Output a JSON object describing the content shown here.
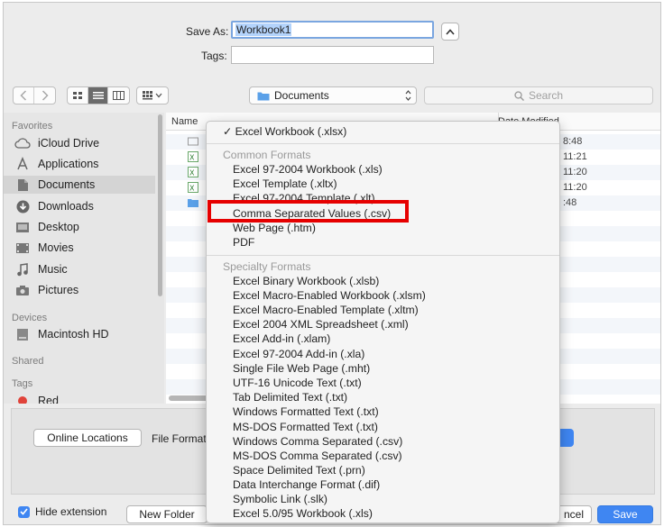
{
  "save_as": {
    "label": "Save As:",
    "value": "Workbook1"
  },
  "tags": {
    "label": "Tags:",
    "value": ""
  },
  "toolbar": {
    "location": "Documents",
    "search_placeholder": "Search"
  },
  "sidebar": {
    "favorites_heading": "Favorites",
    "favorites": [
      "iCloud Drive",
      "Applications",
      "Documents",
      "Downloads",
      "Desktop",
      "Movies",
      "Music",
      "Pictures"
    ],
    "devices_heading": "Devices",
    "devices": [
      "Macintosh HD"
    ],
    "shared_heading": "Shared",
    "tags_heading": "Tags",
    "tags": [
      "Red"
    ]
  },
  "file_list": {
    "name_header": "Name",
    "date_header": "Date Modified",
    "times": [
      "8:48",
      "11:21",
      "11:20",
      "11:20",
      ":48"
    ]
  },
  "options": {
    "online_locations": "Online Locations",
    "file_format_label": "File Format"
  },
  "footer": {
    "hide_extension": "Hide extension",
    "new_folder": "New Folder",
    "cancel": "ncel",
    "save": "Save"
  },
  "format_menu": {
    "selected": "Excel Workbook (.xlsx)",
    "common_heading": "Common Formats",
    "common": [
      "Excel 97-2004 Workbook (.xls)",
      "Excel Template (.xltx)",
      "Excel 97-2004 Template (.xlt)",
      "Comma Separated Values (.csv)",
      "Web Page (.htm)",
      "PDF"
    ],
    "specialty_heading": "Specialty Formats",
    "specialty": [
      "Excel Binary Workbook (.xlsb)",
      "Excel Macro-Enabled Workbook (.xlsm)",
      "Excel Macro-Enabled Template (.xltm)",
      "Excel 2004 XML Spreadsheet (.xml)",
      "Excel Add-in (.xlam)",
      "Excel 97-2004 Add-in (.xla)",
      "Single File Web Page (.mht)",
      "UTF-16 Unicode Text (.txt)",
      "Tab Delimited Text (.txt)",
      "Windows Formatted Text (.txt)",
      "MS-DOS Formatted Text (.txt)",
      "Windows Comma Separated (.csv)",
      "MS-DOS Comma Separated (.csv)",
      "Space Delimited Text (.prn)",
      "Data Interchange Format (.dif)",
      "Symbolic Link (.slk)",
      "Excel 5.0/95 Workbook (.xls)"
    ]
  },
  "colors": {
    "accent": "#3f86f2",
    "highlight_box": "#e60000",
    "tag_red": "#e0433a"
  }
}
